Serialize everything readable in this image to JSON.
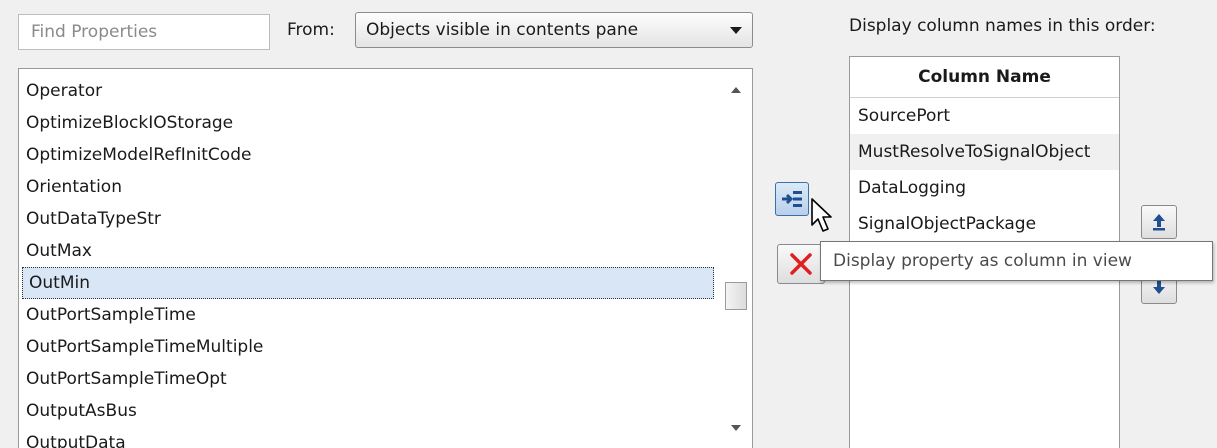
{
  "search": {
    "placeholder": "Find Properties",
    "value": ""
  },
  "from": {
    "label": "From:",
    "selected": "Objects visible in contents pane"
  },
  "order_label": "Display column names in this order:",
  "properties": {
    "items": [
      "Operator",
      "OptimizeBlockIOStorage",
      "OptimizeModelRefInitCode",
      "Orientation",
      "OutDataTypeStr",
      "OutMax",
      "OutMin",
      "OutPortSampleTime",
      "OutPortSampleTimeMultiple",
      "OutPortSampleTimeOpt",
      "OutputAsBus",
      "OutputData"
    ],
    "selected": "OutMin"
  },
  "columns": {
    "header": "Column Name",
    "rows": [
      "SourcePort",
      "MustResolveToSignalObject",
      "DataLogging",
      "SignalObjectPackage"
    ]
  },
  "tooltip": "Display property as column in view",
  "icons": {
    "add": "add-column-icon",
    "remove": "remove-column-icon",
    "up": "move-up-icon",
    "down": "move-down-icon",
    "cursor": "mouse-pointer-icon"
  },
  "colors": {
    "accent": "#1f4f8f",
    "remove": "#e02020",
    "selection": "#d8e6f5"
  }
}
